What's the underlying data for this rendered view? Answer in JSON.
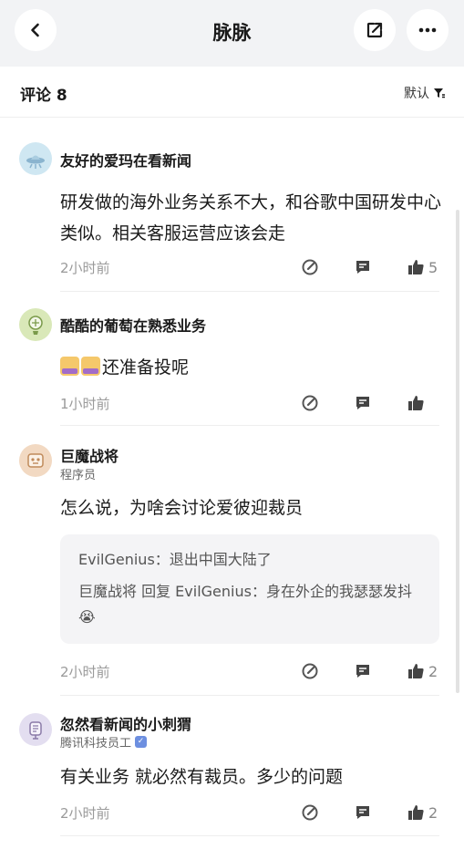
{
  "header": {
    "title": "脉脉",
    "back_icon": "chevron-left-icon",
    "share_icon": "share-external-icon",
    "more_icon": "more-dots-icon"
  },
  "comments_bar": {
    "label": "评论 8",
    "sort_label": "默认",
    "sort_icon": "filter-sort-icon"
  },
  "comments": [
    {
      "author": "友好的爱玛在看新闻",
      "author_sub": "",
      "avatar_icon": "ufo-avatar",
      "text": "研发做的海外业务关系不大，和谷歌中国研发中心类似。相关客服运营应该会走",
      "time": "2小时前",
      "likes": "5"
    },
    {
      "author": "酷酷的葡萄在熟悉业务",
      "author_sub": "",
      "avatar_icon": "plant-avatar",
      "text": "还准备投呢",
      "time": "1小时前",
      "likes": ""
    },
    {
      "author": "巨魔战将",
      "author_sub": "程序员",
      "avatar_icon": "robot-avatar",
      "text": "怎么说，为啥会讨论爱彼迎裁员",
      "time": "2小时前",
      "likes": "2",
      "replies": [
        "EvilGenius：退出中国大陆了",
        "巨魔战将 回复 EvilGenius：身在外企的我瑟瑟发抖😭"
      ]
    },
    {
      "author": "忽然看新闻的小刺猬",
      "author_sub": "腾讯科技员工",
      "avatar_icon": "hedgehog-avatar",
      "text": "有关业务 就必然有裁员。多少的问题",
      "time": "2小时前",
      "likes": "2"
    }
  ],
  "colors": {
    "header_bg": "#f2f3f5",
    "text_primary": "#1a1a1a",
    "text_secondary": "#9a9a9a",
    "reply_bg": "#f4f4f6",
    "verified": "#6d8fe0"
  }
}
